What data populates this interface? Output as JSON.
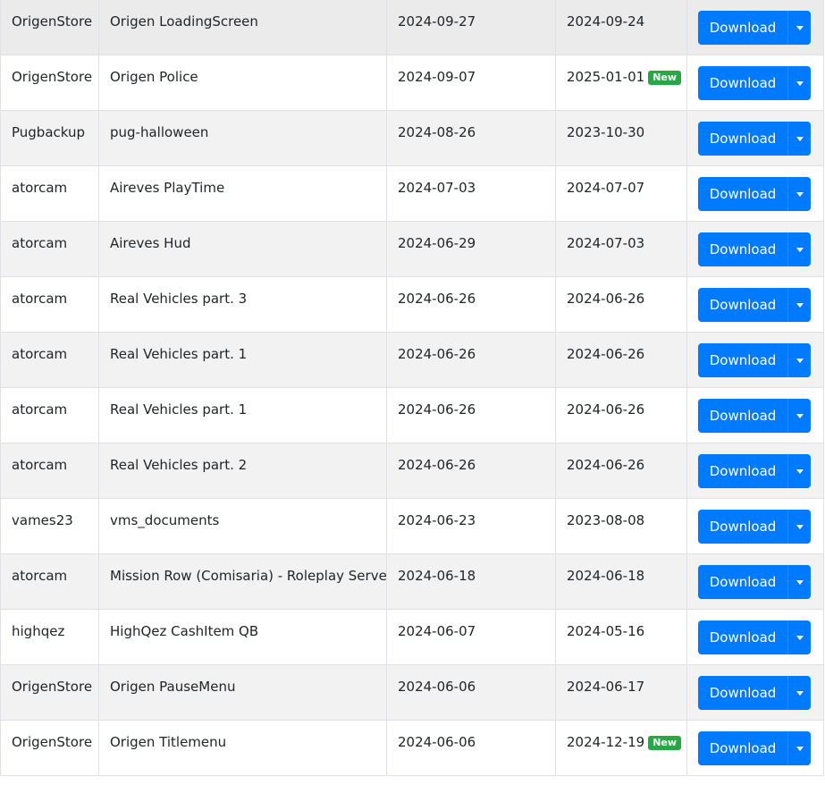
{
  "download_label": "Download",
  "new_badge": "New",
  "colors": {
    "primary": "#007bff",
    "success": "#28a745",
    "stripe": "#f2f2f2",
    "border": "#dee2e6"
  },
  "rows": [
    {
      "author": "OrigenStore",
      "name": "Origen LoadingScreen",
      "date1": "2024-09-27",
      "date2": "2024-09-24",
      "is_new": false
    },
    {
      "author": "OrigenStore",
      "name": "Origen Police",
      "date1": "2024-09-07",
      "date2": "2025-01-01",
      "is_new": true
    },
    {
      "author": "Pugbackup",
      "name": "pug-halloween",
      "date1": "2024-08-26",
      "date2": "2023-10-30",
      "is_new": false
    },
    {
      "author": "atorcam",
      "name": "Aireves PlayTime",
      "date1": "2024-07-03",
      "date2": "2024-07-07",
      "is_new": false
    },
    {
      "author": "atorcam",
      "name": "Aireves Hud",
      "date1": "2024-06-29",
      "date2": "2024-07-03",
      "is_new": false
    },
    {
      "author": "atorcam",
      "name": "Real Vehicles part. 3",
      "date1": "2024-06-26",
      "date2": "2024-06-26",
      "is_new": false
    },
    {
      "author": "atorcam",
      "name": "Real Vehicles part. 1",
      "date1": "2024-06-26",
      "date2": "2024-06-26",
      "is_new": false
    },
    {
      "author": "atorcam",
      "name": "Real Vehicles part. 1",
      "date1": "2024-06-26",
      "date2": "2024-06-26",
      "is_new": false
    },
    {
      "author": "atorcam",
      "name": "Real Vehicles part. 2",
      "date1": "2024-06-26",
      "date2": "2024-06-26",
      "is_new": false
    },
    {
      "author": "vames23",
      "name": "vms_documents",
      "date1": "2024-06-23",
      "date2": "2023-08-08",
      "is_new": false
    },
    {
      "author": "atorcam",
      "name": "Mission Row (Comisaria) - Roleplay Server",
      "date1": "2024-06-18",
      "date2": "2024-06-18",
      "is_new": false
    },
    {
      "author": "highqez",
      "name": "HighQez CashItem QB",
      "date1": "2024-06-07",
      "date2": "2024-05-16",
      "is_new": false
    },
    {
      "author": "OrigenStore",
      "name": "Origen PauseMenu",
      "date1": "2024-06-06",
      "date2": "2024-06-17",
      "is_new": false
    },
    {
      "author": "OrigenStore",
      "name": "Origen Titlemenu",
      "date1": "2024-06-06",
      "date2": "2024-12-19",
      "is_new": true
    }
  ]
}
